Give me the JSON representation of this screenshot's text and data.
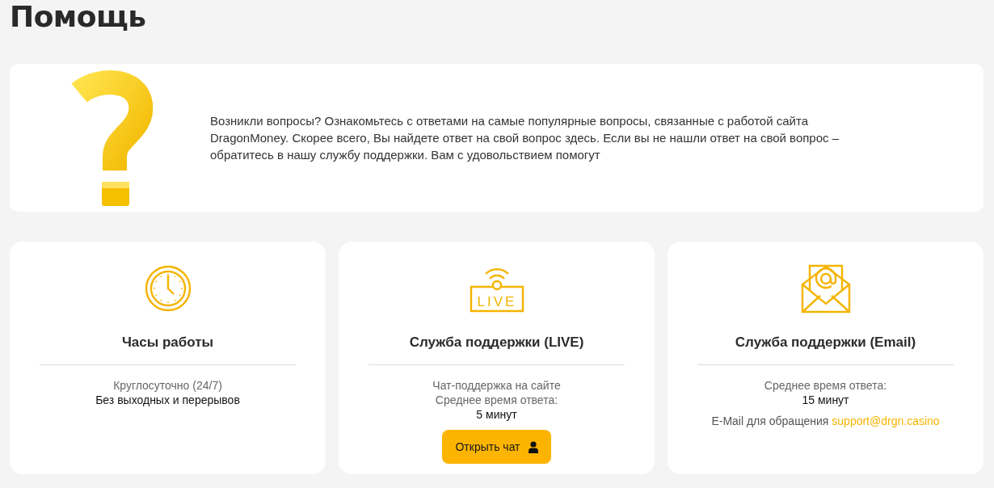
{
  "page": {
    "title": "Помощь"
  },
  "intro": {
    "text": "Возникли вопросы? Ознакомьтесь с ответами на самые популярные вопросы, связанные с работой сайта DragonMoney. Скорее всего, Вы найдете ответ на свой вопрос здесь. Если вы не нашли ответ на свой вопрос – обратитесь в нашу службу поддержки. Вам с удовольствием помогут"
  },
  "cards": [
    {
      "kind": "clock",
      "title": "Часы работы",
      "lines": [
        {
          "kind": "note",
          "text": "Круглосуточно (24/7)"
        },
        {
          "kind": "strong",
          "text": "Без выходных и перерывов"
        }
      ]
    },
    {
      "kind": "live",
      "icon_label": "LIVE",
      "title": "Служба поддержки (LIVE)",
      "lines": [
        {
          "kind": "note",
          "text": "Чат-поддержка на сайте"
        },
        {
          "kind": "note",
          "text": "Среднее время ответа:"
        },
        {
          "kind": "strong",
          "text": "5 минут"
        }
      ],
      "button": {
        "label": "Открыть чат"
      }
    },
    {
      "kind": "email",
      "title": "Служба поддержки (Email)",
      "lines": [
        {
          "kind": "note",
          "text": "Среднее время ответа:"
        },
        {
          "kind": "strong",
          "text": "15 минут"
        },
        {
          "kind": "contact",
          "text": "E-Mail для обращения",
          "link": "support@drgn.casino"
        }
      ]
    }
  ]
}
